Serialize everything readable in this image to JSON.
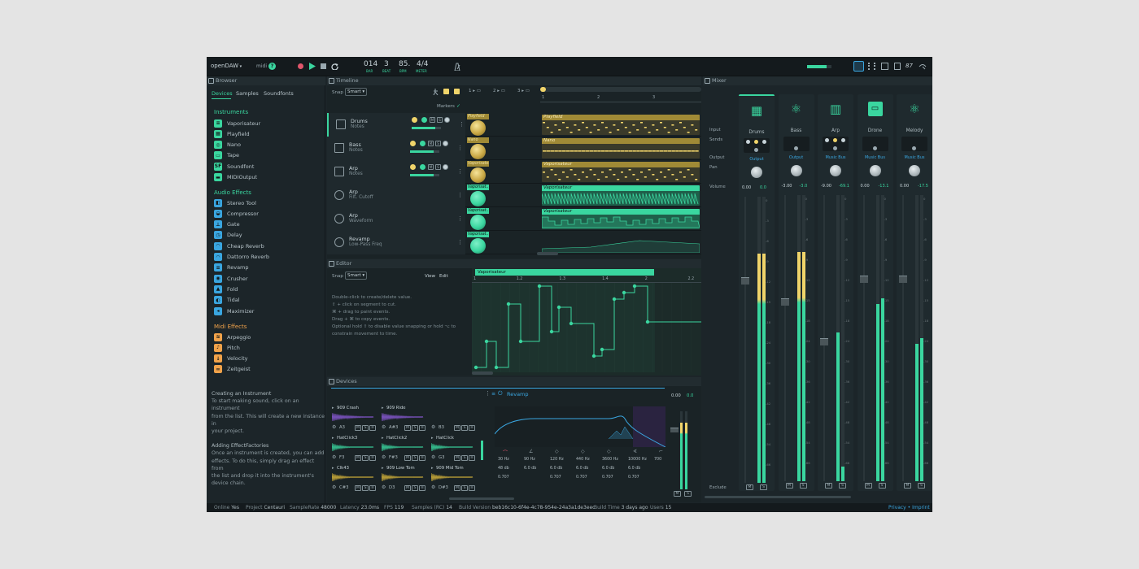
{
  "header": {
    "app_name": "openDAW",
    "midi_label": "midi",
    "midi_badge": "?",
    "position": {
      "bar": "014",
      "beat": "3",
      "bpm": "85.",
      "meter": "4/4"
    },
    "position_labels": {
      "bar": "BAR",
      "beat": "BEAT",
      "bpm": "BPM",
      "meter": "METER"
    },
    "view_label": "87"
  },
  "browser": {
    "title": "Browser",
    "tabs": [
      "Devices",
      "Samples",
      "Soundfonts"
    ],
    "sections": {
      "instruments": "Instruments",
      "audio_effects": "Audio Effects",
      "midi_effects": "Midi Effects"
    },
    "instruments": [
      "Vaporisateur",
      "Playfield",
      "Nano",
      "Tape",
      "Soundfont",
      "MIDIOutput"
    ],
    "instrument_glyphs": [
      "≡",
      "▦",
      "◎",
      "▭",
      "SF",
      "▬"
    ],
    "audio_effects": [
      "Stereo Tool",
      "Compressor",
      "Gate",
      "Delay",
      "Cheap Reverb",
      "Dattorro Reverb",
      "Revamp",
      "Crusher",
      "Fold",
      "Tidal",
      "Maximizer"
    ],
    "audio_effect_glyphs": [
      "◧",
      "◒",
      "⊥",
      "◷",
      "◠",
      "◠",
      "≡",
      "◉",
      "▲",
      "◐",
      "◂"
    ],
    "midi_effects": [
      "Arpeggio",
      "Pitch",
      "Velocity",
      "Zeitgeist"
    ],
    "midi_effect_glyphs": [
      "≋",
      "♪",
      "↓",
      "∞"
    ],
    "help": [
      {
        "heading": "Creating an Instrument",
        "lines": [
          "To start making sound, click on an instrument",
          "from the list. This will create a new instance in",
          "your project."
        ]
      },
      {
        "heading": "Adding EffectFactories",
        "lines": [
          "Once an instrument is created, you can add",
          "effects. To do this, simply drag an effect from",
          "the list and drop it into the instrument's",
          "device chain."
        ]
      }
    ]
  },
  "timeline": {
    "title": "Timeline",
    "snap_label": "Snap",
    "snap_value": "Smart",
    "markers_label": "Markers",
    "scenes": [
      "1",
      "2",
      "3"
    ],
    "ruler": [
      "1",
      "2",
      "3"
    ],
    "tracks": [
      {
        "name": "Drums",
        "sub": "Notes",
        "slot": "Playfield",
        "clip": "Playfield"
      },
      {
        "name": "Bass",
        "sub": "Notes",
        "slot": "Nano",
        "clip": "Nano"
      },
      {
        "name": "Arp",
        "sub": "Notes",
        "slot": "Vaporisateur",
        "clip": "Vaporisateur"
      },
      {
        "name": "Arp",
        "sub": "Filt. Cutoff",
        "slot": "Vaporisat..",
        "clip": "Vaporisateur"
      },
      {
        "name": "Arp",
        "sub": "Waveform",
        "slot": "Vaporisat..",
        "clip": "Vaporisateur"
      },
      {
        "name": "Revamp",
        "sub": "Low-Pass Freq",
        "slot": "Vaporisat..",
        "clip": ""
      }
    ],
    "track_button_labels": [
      "M",
      "S"
    ]
  },
  "editor": {
    "title": "Editor",
    "snap_label": "Snap",
    "snap_value": "Smart",
    "view_label": "View",
    "edit_label": "Edit",
    "clip_name": "Vaporisateur",
    "ruler": [
      "1",
      "1.2",
      "1.3",
      "1.4",
      "2",
      "2.2"
    ],
    "help_lines": [
      "Double-click to create/delete value.",
      "⇧ + click on segment to cut.",
      "⌘ + drag to paint events.",
      "Drag + ⌘ to copy events.",
      "Optional hold ⇧ to disable value snapping or hold ⌥ to",
      "constrain movement to time."
    ]
  },
  "devices": {
    "title": "Devices",
    "device_name": "Revamp",
    "pads": [
      {
        "name": "909 Crash",
        "note": "A3"
      },
      {
        "name": "909 Ride",
        "note": "A#3"
      },
      {
        "name": "",
        "note": "B3"
      },
      {
        "name": "HatClick3",
        "note": "F3"
      },
      {
        "name": "HatClick2",
        "note": "F#3"
      },
      {
        "name": "HatClick",
        "note": "G3"
      },
      {
        "name": "Clk43",
        "note": "C#3"
      },
      {
        "name": "909 Low Tom",
        "note": "D3"
      },
      {
        "name": "909 Mid Tom",
        "note": "D#3"
      }
    ],
    "eq_freqs": [
      "30 Hz",
      "90 Hz",
      "120 Hz",
      "440 Hz",
      "3600 Hz",
      "10000 Hz",
      "700"
    ],
    "eq_gains": [
      "48 db",
      "6.0 db",
      "6.0 db",
      "6.0 db",
      "6.0 db",
      "6.0 db",
      ""
    ],
    "eq_qs": [
      "0.707",
      "",
      "0.707",
      "0.707",
      "0.707",
      "0.707",
      ""
    ],
    "out_values": [
      "0.00",
      "0.0"
    ],
    "pad_btn_labels": [
      "M",
      "S",
      "≡"
    ]
  },
  "mixer": {
    "title": "Mixer",
    "row_labels": [
      "Input",
      "Sends",
      "Output",
      "Pan",
      "Volume",
      "Exclude"
    ],
    "channels": [
      {
        "name": "Drums",
        "output": "Output",
        "vol_a": "0.00",
        "vol_b": "0.0",
        "glyph": "▦"
      },
      {
        "name": "Bass",
        "output": "Output",
        "vol_a": "-3.00",
        "vol_b": "-3.0",
        "glyph": "⚛"
      },
      {
        "name": "Arp",
        "output": "Music Bus",
        "vol_a": "-9.00",
        "vol_b": "-69.1",
        "glyph": "▥"
      },
      {
        "name": "Drone",
        "output": "Music Bus",
        "vol_a": "0.00",
        "vol_b": "-13.1",
        "glyph": "▭"
      },
      {
        "name": "Melody",
        "output": "Music Bus",
        "vol_a": "0.00",
        "vol_b": "-17.5",
        "glyph": "⚛"
      }
    ],
    "db_scale": [
      "0",
      "-3",
      "-6",
      "-9",
      "-12",
      "-15",
      "-18",
      "-24",
      "-30",
      "-36",
      "-42",
      "-48",
      "-54",
      "-66"
    ],
    "strip_btn_labels": [
      "M",
      "S"
    ]
  },
  "status": {
    "online_label": "Online",
    "online_value": "Yes",
    "project_label": "Project",
    "project_value": "Centauri",
    "samplerate_label": "SampleRate",
    "samplerate_value": "48000",
    "latency_label": "Latency",
    "latency_value": "23.0ms",
    "fps_label": "FPS",
    "fps_value": "119",
    "samples_label": "Samples (RC)",
    "samples_value": "14",
    "build_version_label": "Build Version",
    "build_version_value": "beb16c10-6f4e-4c78-954e-24a3a1de3eec",
    "build_time_label": "Build Time",
    "build_time_value": "3 days ago",
    "users_label": "Users",
    "users_value": "15",
    "privacy": "Privacy • Imprint"
  },
  "colors": {
    "accent": "#3ad69f",
    "midi": "#f0a24a",
    "audio": "#3aa6e0",
    "warning": "#f0d46a",
    "background": "#1c2529"
  }
}
